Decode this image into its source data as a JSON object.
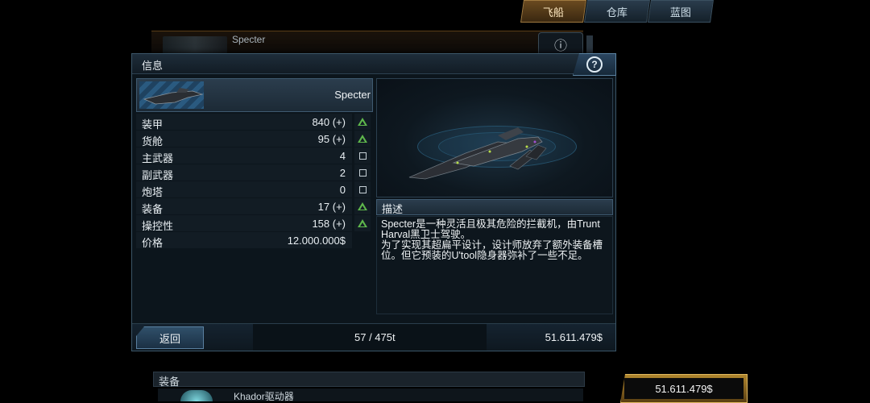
{
  "tabs": [
    {
      "label": "飞船",
      "active": true
    },
    {
      "label": "仓库",
      "active": false
    },
    {
      "label": "蓝图",
      "active": false
    }
  ],
  "background_list": {
    "ship_name": "Specter"
  },
  "dialog": {
    "title": "信息",
    "ship_name": "Specter",
    "stats": [
      {
        "label": "装甲",
        "value": "840 (+)",
        "control": "upgrade"
      },
      {
        "label": "货舱",
        "value": "95 (+)",
        "control": "upgrade"
      },
      {
        "label": "主武器",
        "value": "4",
        "control": "slot"
      },
      {
        "label": "副武器",
        "value": "2",
        "control": "slot"
      },
      {
        "label": "炮塔",
        "value": "0",
        "control": "slot"
      },
      {
        "label": "装备",
        "value": "17 (+)",
        "control": "upgrade"
      },
      {
        "label": "操控性",
        "value": "158 (+)",
        "control": "upgrade"
      },
      {
        "label": "价格",
        "value": "12.000.000$",
        "control": "none"
      }
    ],
    "description": {
      "header": "描述",
      "paragraph1": "Specter是一种灵活且极其危险的拦截机，由Trunt Harval黑卫士驾驶。",
      "paragraph2": "为了实现其超扁平设计，设计师放弃了额外装备槽位。但它预装的U'tool隐身器弥补了一些不足。"
    },
    "back_label": "返回",
    "cargo": "57 / 475t",
    "credits": "51.611.479$"
  },
  "equipment_header": "装备",
  "equipment_item": "Khador驱动器",
  "bottom_credits": "51.611.479$",
  "colors": {
    "upgrade_arrow": "#5fb84c",
    "active_tab": "#6a4a20",
    "panel_border": "#3b5668"
  }
}
